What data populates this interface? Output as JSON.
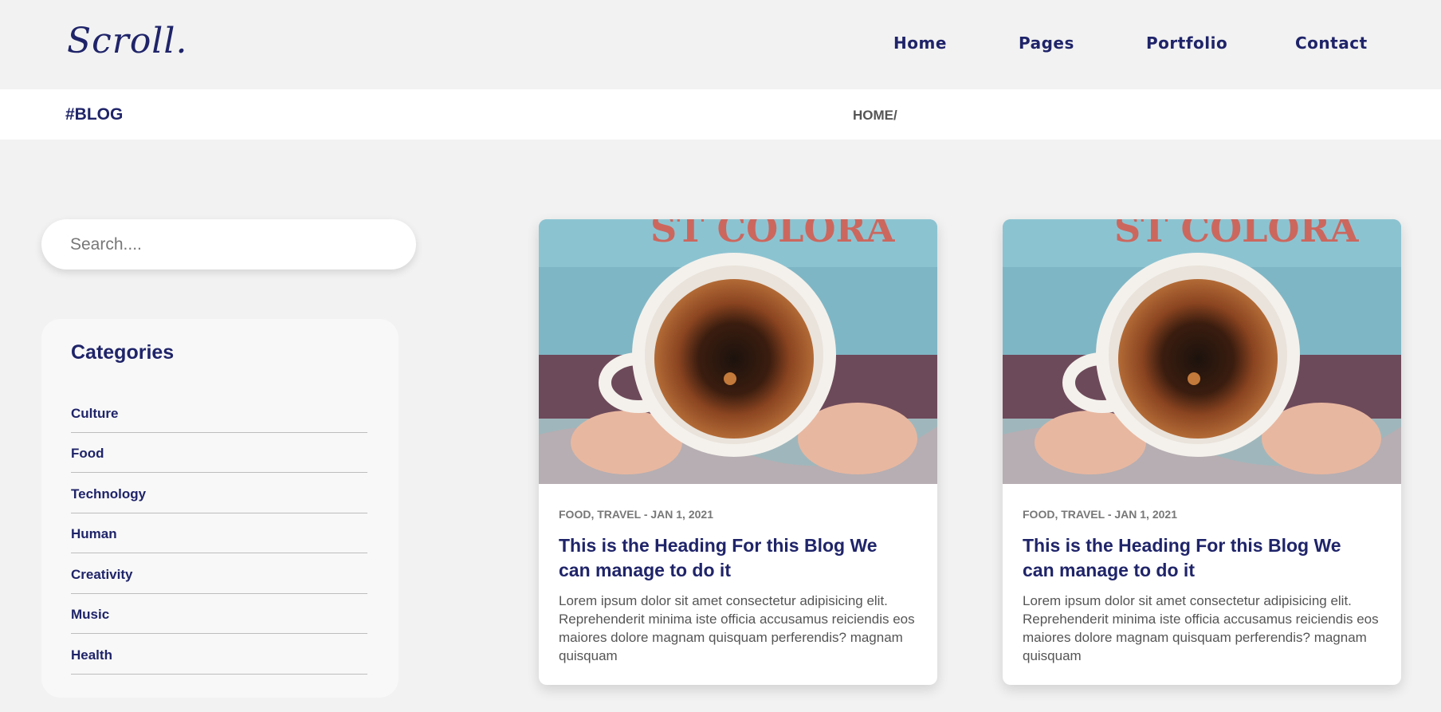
{
  "header": {
    "logo": "Scroll.",
    "nav": [
      "Home",
      "Pages",
      "Portfolio",
      "Contact"
    ]
  },
  "breadcrumb": {
    "title": "#BLOG",
    "path": "HOME/"
  },
  "sidebar": {
    "search_placeholder": "Search....",
    "categories_title": "Categories",
    "categories": [
      "Culture",
      "Food",
      "Technology",
      "Human",
      "Creativity",
      "Music",
      "Health"
    ]
  },
  "posts": [
    {
      "meta": "FOOD, TRAVEL - JAN 1, 2021",
      "title": "This is the Heading For this Blog We can manage to do it",
      "excerpt": "Lorem ipsum dolor sit amet consectetur adipisicing elit. Reprehenderit minima iste officia accusamus reiciendis eos maiores dolore magnam quisquam perferendis? magnam quisquam"
    },
    {
      "meta": "FOOD, TRAVEL - JAN 1, 2021",
      "title": "This is the Heading For this Blog We can manage to do it",
      "excerpt": "Lorem ipsum dolor sit amet consectetur adipisicing elit. Reprehenderit minima iste officia accusamus reiciendis eos maiores dolore magnam quisquam perferendis? magnam quisquam"
    }
  ],
  "colors": {
    "brand": "#1f2469",
    "background": "#f2f2f2"
  }
}
